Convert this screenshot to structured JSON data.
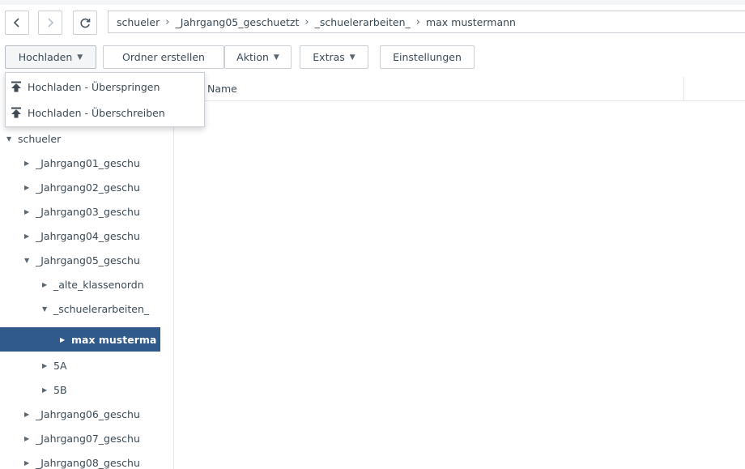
{
  "navigation": {
    "back_icon": "chevron-left-icon",
    "forward_icon": "chevron-right-icon",
    "refresh_icon": "refresh-icon",
    "breadcrumb": [
      "schueler",
      "_Jahrgang05_geschuetzt",
      "_schuelerarbeiten_",
      "max mustermann"
    ]
  },
  "toolbar": {
    "upload_label": "Hochladen",
    "create_folder_label": "Ordner erstellen",
    "action_label": "Aktion",
    "extras_label": "Extras",
    "settings_label": "Einstellungen"
  },
  "upload_menu": {
    "items": [
      {
        "label": "Hochladen - Überspringen",
        "icon": "upload-icon"
      },
      {
        "label": "Hochladen - Überschreiben",
        "icon": "upload-icon"
      }
    ]
  },
  "file_list": {
    "column_name": "Name"
  },
  "tree": {
    "items": [
      {
        "label": "schueler",
        "expanded": true
      },
      {
        "label": "_Jahrgang01_geschu",
        "expanded": false
      },
      {
        "label": "_Jahrgang02_geschu",
        "expanded": false
      },
      {
        "label": "_Jahrgang03_geschu",
        "expanded": false
      },
      {
        "label": "_Jahrgang04_geschu",
        "expanded": false
      },
      {
        "label": "_Jahrgang05_geschu",
        "expanded": true
      },
      {
        "label": "_alte_klassenordn",
        "expanded": false
      },
      {
        "label": "_schuelerarbeiten_",
        "expanded": true
      },
      {
        "label": "max musterma",
        "expanded": false,
        "selected": true
      },
      {
        "label": "5A",
        "expanded": false
      },
      {
        "label": "5B",
        "expanded": false
      },
      {
        "label": "_Jahrgang06_geschu",
        "expanded": false
      },
      {
        "label": "_Jahrgang07_geschu",
        "expanded": false
      },
      {
        "label": "_Jahrgang08_geschu",
        "expanded": false
      }
    ]
  },
  "colors": {
    "selected_bg": "#2f5a8a",
    "border": "#c9cfd5",
    "text": "#3a4a55"
  }
}
